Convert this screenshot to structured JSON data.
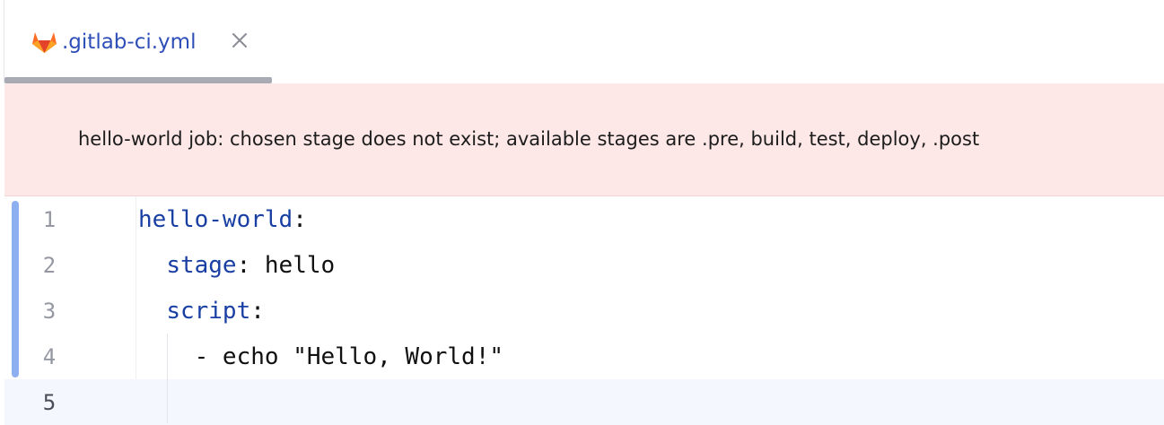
{
  "tab": {
    "filename": ".gitlab-ci.yml",
    "icon": "gitlab-icon",
    "close_icon": "close-icon"
  },
  "error_banner": {
    "message": "hello-world job: chosen stage does not exist; available stages are .pre, build, test, deploy, .post"
  },
  "editor": {
    "current_line": 5,
    "lines": [
      {
        "number": "1",
        "indent": "",
        "key": "hello-world",
        "punct": ":",
        "value": ""
      },
      {
        "number": "2",
        "indent": "  ",
        "key": "stage",
        "punct": ":",
        "value": " hello"
      },
      {
        "number": "3",
        "indent": "  ",
        "key": "script",
        "punct": ":",
        "value": ""
      },
      {
        "number": "4",
        "indent": "    ",
        "key": "",
        "punct": "",
        "value": "- echo \"Hello, World!\""
      },
      {
        "number": "5",
        "indent": "",
        "key": "",
        "punct": "",
        "value": ""
      }
    ]
  },
  "colors": {
    "tab_label": "#2f4fb8",
    "error_background": "#fde7e7",
    "yaml_key": "#1a3fa3",
    "change_marker": "#8fb0f0",
    "current_line_background": "#f4f7fe"
  }
}
